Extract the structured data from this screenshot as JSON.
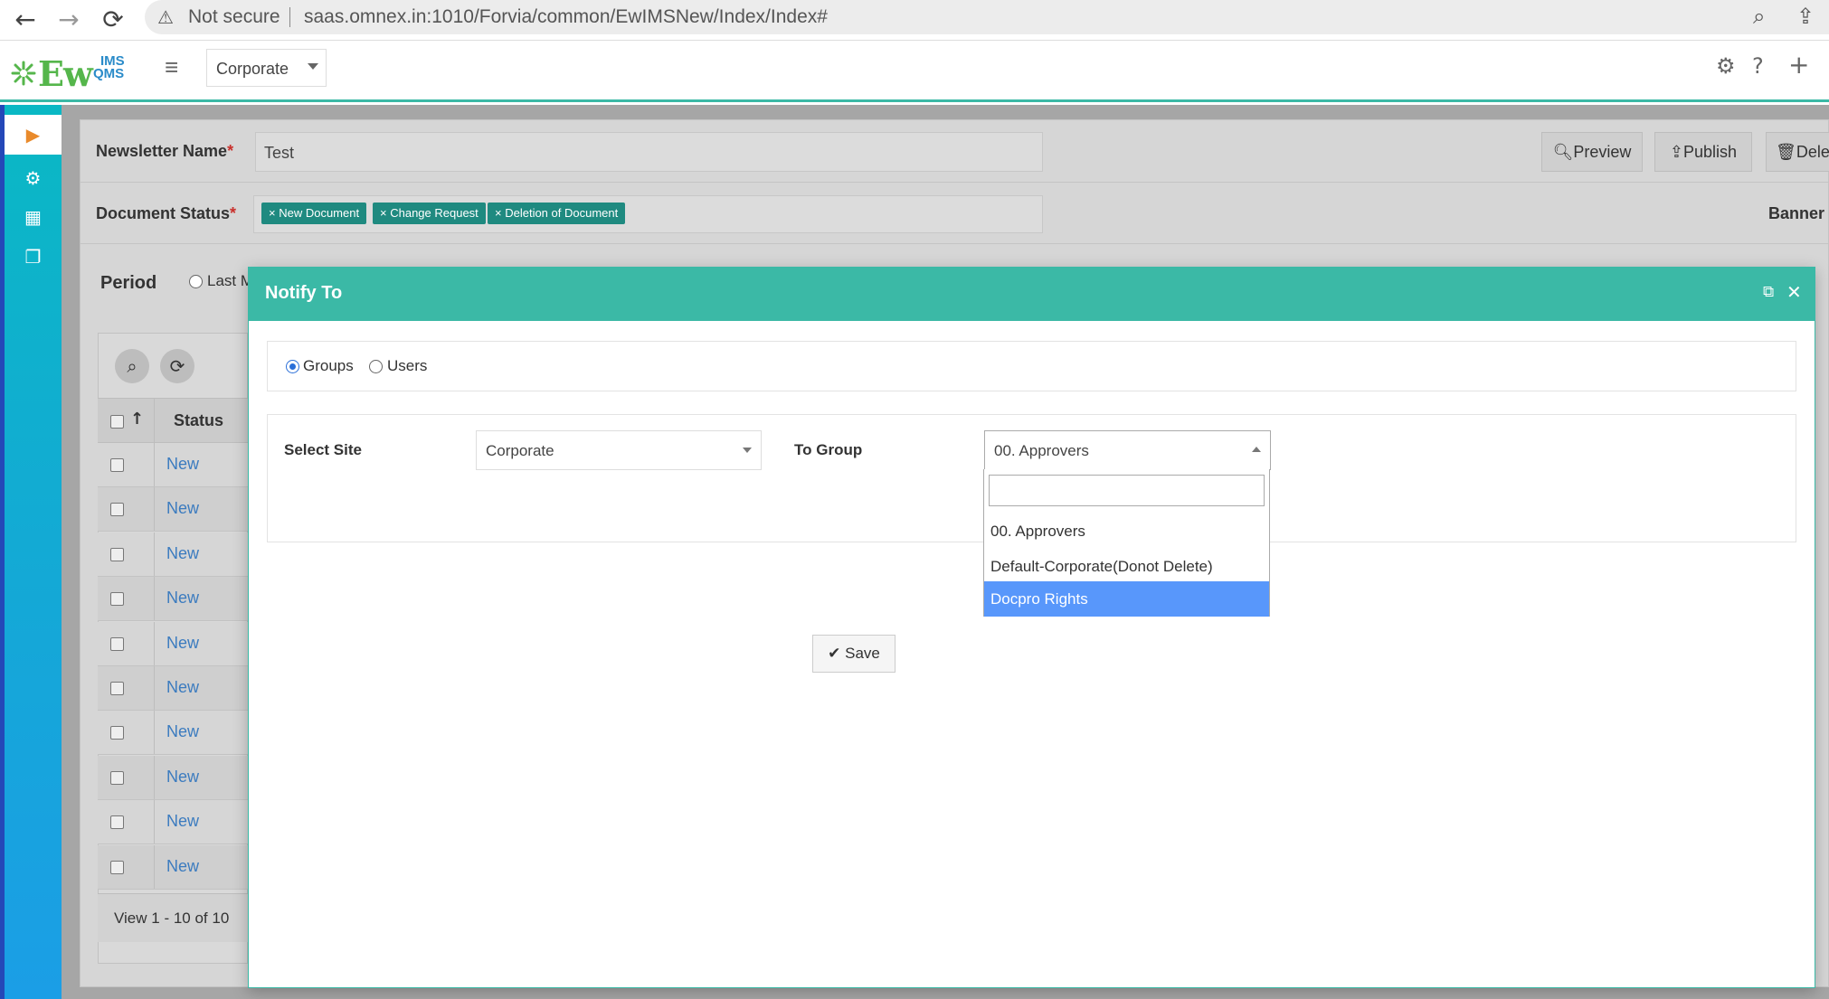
{
  "browser": {
    "back_icon": "←",
    "forward_icon": "→",
    "reload_icon": "⟳",
    "security_label": "Not secure",
    "url": "saas.omnex.in:1010/Forvia/common/EwIMSNew/Index/Index#"
  },
  "header": {
    "logo_main": "Ew",
    "logo_sub_top": "IMS",
    "logo_sub_bottom": "QMS",
    "site": "Corporate"
  },
  "form": {
    "newsletter_label": "Newsletter Name",
    "newsletter_value": "Test",
    "doc_status_label": "Document Status",
    "tags": [
      "New Document",
      "Change Request",
      "Deletion of Document"
    ],
    "period_label": "Period",
    "period_option": "Last M",
    "banner_label": "Banner",
    "preview_label": "Preview",
    "publish_label": "Publish",
    "delete_label": "Delet"
  },
  "grid": {
    "status_header": "Status",
    "rows": [
      "New",
      "New",
      "New",
      "New",
      "New",
      "New",
      "New",
      "New",
      "New",
      "New"
    ],
    "pager": "View 1 - 10 of 10"
  },
  "modal": {
    "title": "Notify To",
    "radio_groups": "Groups",
    "radio_users": "Users",
    "select_site_label": "Select Site",
    "select_site_value": "Corporate",
    "to_group_label": "To Group",
    "to_group_value": "00. Approvers",
    "options": [
      "00. Approvers",
      "Default-Corporate(Donot Delete)",
      "Docpro Rights"
    ],
    "highlighted_option": "Docpro Rights",
    "save_label": "Save"
  },
  "colors": {
    "accent": "#3bb9a6",
    "tag": "#1f8a80",
    "highlight": "#5897fb",
    "link": "#3b7bbf"
  }
}
